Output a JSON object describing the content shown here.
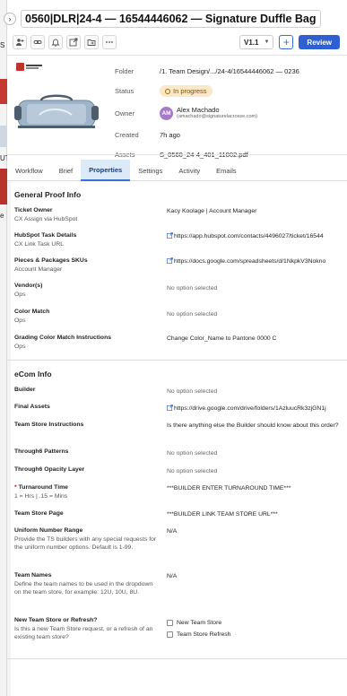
{
  "background_window": {
    "letters": [
      "S",
      "UT",
      "e"
    ]
  },
  "header": {
    "title": "0560|DLR|24-4 — 16544446062 — Signature Duffle Bag",
    "version": "V1.1",
    "review_label": "Review",
    "toolbar_icons": [
      "add-user-icon",
      "link-icon",
      "bell-icon",
      "export-icon",
      "folder-move-icon",
      "more-icon"
    ]
  },
  "asset": {
    "folder_label": "Folder",
    "folder_value": "/1. Team Design/.../24-4/16544446062 — 0236",
    "status_label": "Status",
    "status_value": "In progress",
    "owner_label": "Owner",
    "owner_initials": "AM",
    "owner_name": "Alex Machado",
    "owner_email": "(amachado@signaturelacrosse.com)",
    "created_label": "Created",
    "created_value": "7h ago",
    "assets_label": "Assets",
    "assets_value": "S_0560_24-4_401_11002.pdf"
  },
  "tabs": [
    {
      "label": "Workflow"
    },
    {
      "label": "Brief"
    },
    {
      "label": "Properties"
    },
    {
      "label": "Settings"
    },
    {
      "label": "Activity"
    },
    {
      "label": "Emails"
    }
  ],
  "general": {
    "title": "General Proof Info",
    "fields": [
      {
        "label": "Ticket Owner",
        "sub": "CX Assign via HubSpot",
        "value": "Kacy Koolage | Account Manager"
      },
      {
        "label": "HubSpot Task Details",
        "sub": "CX Link Task URL",
        "value": "https://app.hubspot.com/contacts/4496027/ticket/16544"
      },
      {
        "label": "Pieces & Packages SKUs",
        "sub": "Account Manager",
        "value": "https://docs.google.com/spreadsheets/d/1NkpkV3Nokno"
      },
      {
        "label": "Vendor(s)",
        "sub": "Ops",
        "value": "No option selected"
      },
      {
        "label": "Color Match",
        "sub": "Ops",
        "value": "No option selected"
      },
      {
        "label": "Grading Color Match Instructions",
        "sub": "Ops",
        "value": "Change Color_Name to Pantone 0000 C"
      }
    ]
  },
  "ecom": {
    "title": "eCom Info",
    "fields": [
      {
        "label": "Builder",
        "sub": "",
        "value": "No option selected"
      },
      {
        "label": "Final Assets",
        "sub": "",
        "value": "https://drive.google.com/drive/folders/1AzluucRk3zjGN1j"
      },
      {
        "label": "Team Store Instructions",
        "sub": "",
        "value": "Is there anything else the Builder should know about this order?"
      },
      {
        "label": "Through6 Patterns",
        "sub": "",
        "value": "No option selected"
      },
      {
        "label": "Through6 Opacity Layer",
        "sub": "",
        "value": "No option selected"
      },
      {
        "label": "Turnaround Time",
        "sub": "1 = Hrs | .15 = Mins",
        "value": "***BUILDER ENTER TURNAROUND TIME***"
      },
      {
        "label": "Team Store Page",
        "sub": "",
        "value": "***BUILDER LINK TEAM STORE URL***"
      },
      {
        "label": "Uniform Number Range",
        "sub": "Provide the TS builders with any special requests for the uniform number options. Default is 1-99.",
        "value": "N/A"
      },
      {
        "label": "Team Names",
        "sub": "Define the team names to be used in the dropdown on the team store, for example: 12U, 10U, 8U.",
        "value": "N/A"
      },
      {
        "label": "New Team Store or Refresh?",
        "sub": "Is this a new Team Store request, or a refresh of an existing team store?",
        "options": [
          "New Team Store",
          "Team Store Refresh"
        ]
      }
    ]
  },
  "colors": {
    "accent": "#2f5fd0",
    "status_bg": "#fbe8c8",
    "tab_active_bg": "#dce9f7",
    "avatar": "#a679c9"
  }
}
